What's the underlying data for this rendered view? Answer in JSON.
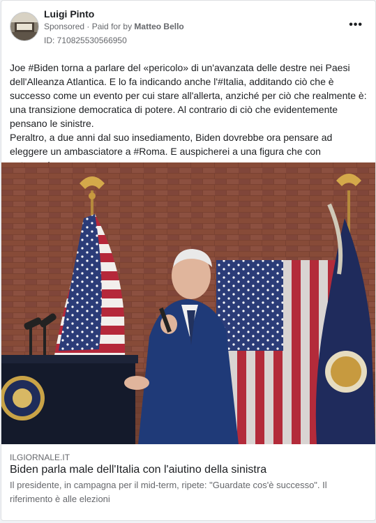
{
  "header": {
    "page_name": "Luigi Pinto",
    "sponsored": "Sponsored",
    "paid_for_prefix": " · Paid for by ",
    "payer": "Matteo Bello",
    "ad_id": "ID: 710825530566950",
    "more_icon": "more-horizontal-icon",
    "more_label": "•••"
  },
  "post": {
    "paragraphs": [
      "Joe #Biden torna a parlare del «pericolo» di un'avanzata delle destre nei Paesi dell'Alleanza Atlantica. E lo fa indicando anche l'#Italia, additando ciò che è successo come un evento per cui stare all'allerta, anziché per ciò che realmente è: una transizione democratica di potere. Al contrario di ciò che evidentemente pensano le sinistre.",
      "Peraltro, a due anni dal suo insediamento, Biden dovrebbe ora pensare ad eleggere un ambasciatore a #Roma. E auspicherei a una figura che con autorevolezza..."
    ]
  },
  "link": {
    "domain": "ILGIORNALE.IT",
    "title": "Biden parla male dell'Italia con l'aiutino della sinistra",
    "description": "Il presidente, in campagna per il mid-term, ripete: \"Guardate cos'è successo\". Il riferimento è alle elezioni"
  },
  "colors": {
    "text": "#1c1e21",
    "secondary": "#65676b",
    "brick": "#6b3a2c"
  }
}
